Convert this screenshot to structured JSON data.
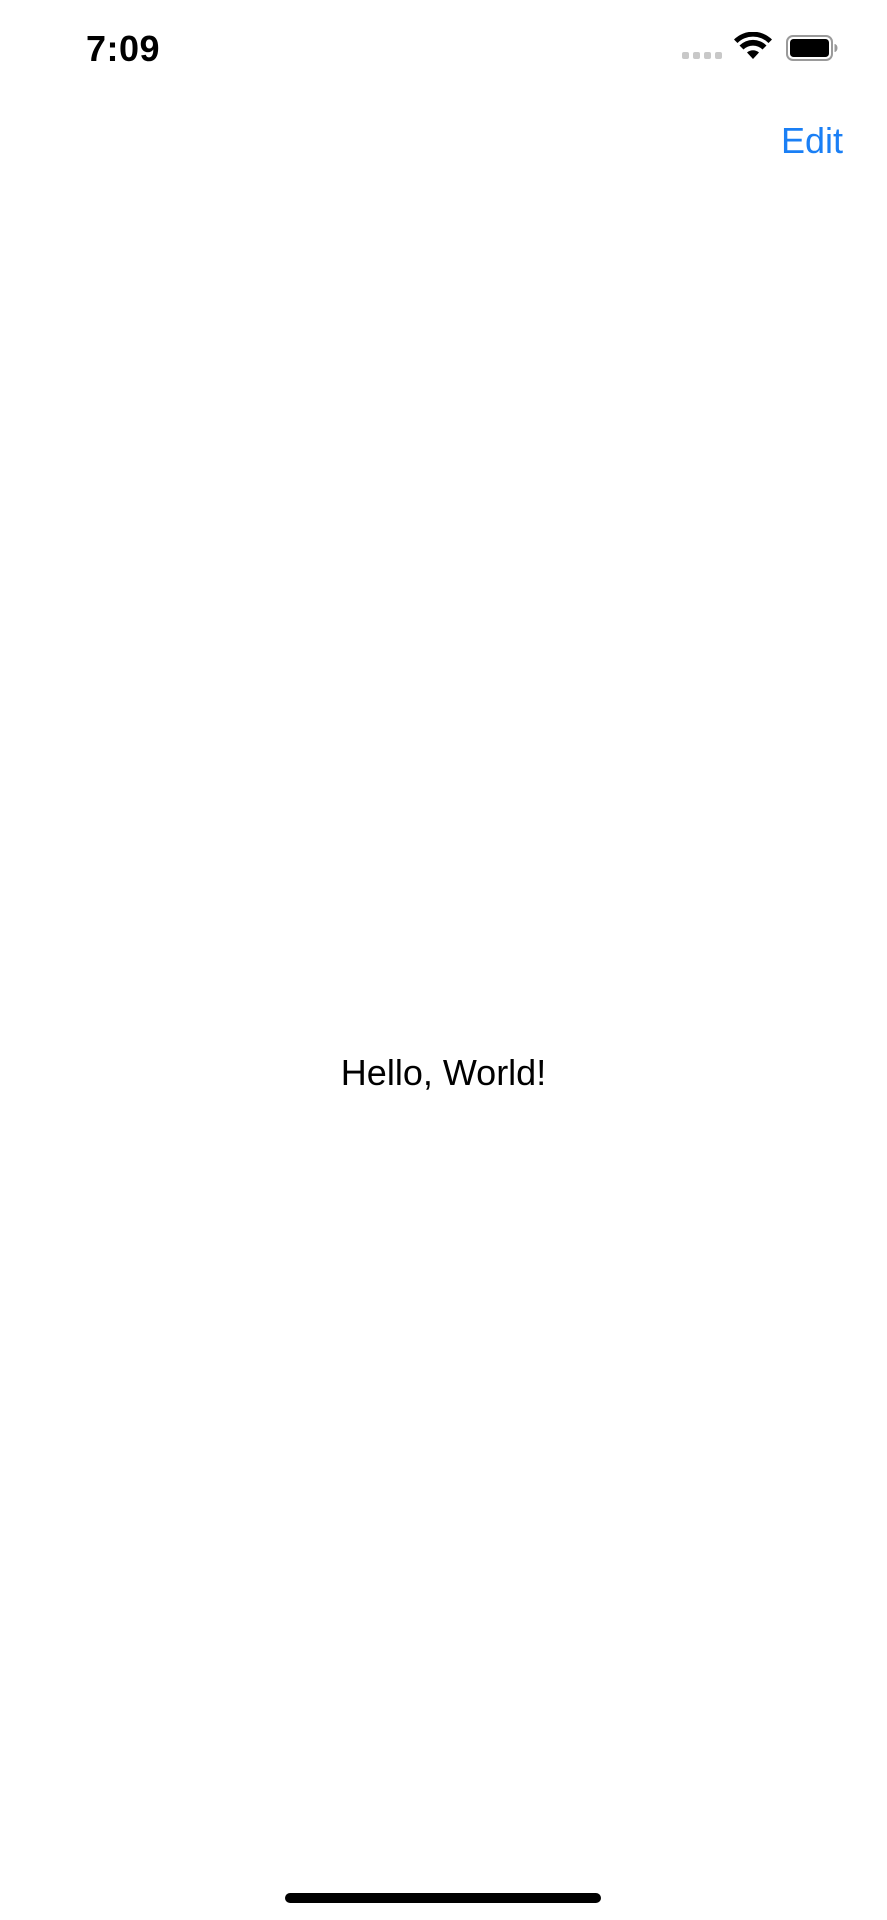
{
  "status_bar": {
    "time": "7:09",
    "signal_icon": "cellular-signal-icon",
    "wifi_icon": "wifi-icon",
    "battery_icon": "battery-icon"
  },
  "nav_bar": {
    "edit_label": "Edit"
  },
  "content": {
    "message": "Hello, World!"
  },
  "colors": {
    "accent": "#1a7ff5",
    "text": "#000000",
    "background": "#ffffff"
  }
}
